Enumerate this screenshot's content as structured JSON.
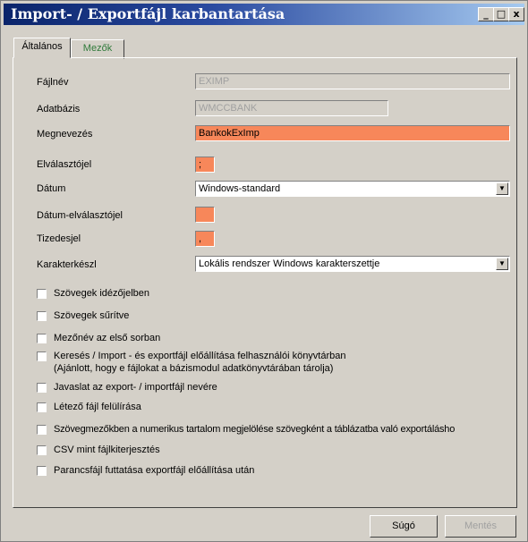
{
  "window": {
    "title": "Import- / Exportfájl karbantartása",
    "min_glyph": "_",
    "max_glyph": "□",
    "close_glyph": "x"
  },
  "tabs": [
    {
      "label": "Általános",
      "active": true
    },
    {
      "label": "Mezők",
      "active": false,
      "color": "#2f7a3a"
    }
  ],
  "form": {
    "fajlnev": {
      "label": "Fájlnév",
      "value": "EXIMP"
    },
    "adatbazis": {
      "label": "Adatbázis",
      "value": "WMCCBANK"
    },
    "megnevezes": {
      "label": "Megnevezés",
      "value": "BankokExImp"
    },
    "elvalaszto": {
      "label": "Elválasztójel",
      "value": ";"
    },
    "datum": {
      "label": "Dátum",
      "value": "Windows-standard"
    },
    "datum_elvalaszto": {
      "label": "Dátum-elválasztójel",
      "value": ""
    },
    "tizedesjel": {
      "label": "Tizedesjel",
      "value": ","
    },
    "karakterkeszlet": {
      "label": "Karakterkészl",
      "value": "Lokális rendszer Windows karakterszettje"
    }
  },
  "checkboxes": [
    {
      "label": "Szövegek idézőjelben",
      "checked": false
    },
    {
      "label": "Szövegek sűrítve",
      "checked": false
    },
    {
      "label": "Mezőnév az első sorban",
      "checked": false
    },
    {
      "label": "Keresés / Import - és exportfájl előállítása felhasználói könyvtárban",
      "note": "(Ajánlott, hogy e fájlokat a bázismodul adatkönyvtárában tárolja)",
      "checked": false
    },
    {
      "label": "Javaslat az export- / importfájl nevére",
      "checked": false
    },
    {
      "label": "Létező fájl felülírása",
      "checked": false
    },
    {
      "label": "Szövegmezőkben a numerikus tartalom megjelölése szövegként a táblázatba való exportálásho",
      "checked": false
    },
    {
      "label": "CSV mint fájlkiterjesztés",
      "checked": false
    },
    {
      "label": "Parancsfájl futtatása exportfájl előállítása után",
      "checked": false
    }
  ],
  "buttons": {
    "help": "Súgó",
    "save": "Mentés"
  },
  "colors": {
    "highlight_field": "#f7875a",
    "title_gradient_start": "#0a246a",
    "title_gradient_end": "#a6caf0"
  }
}
